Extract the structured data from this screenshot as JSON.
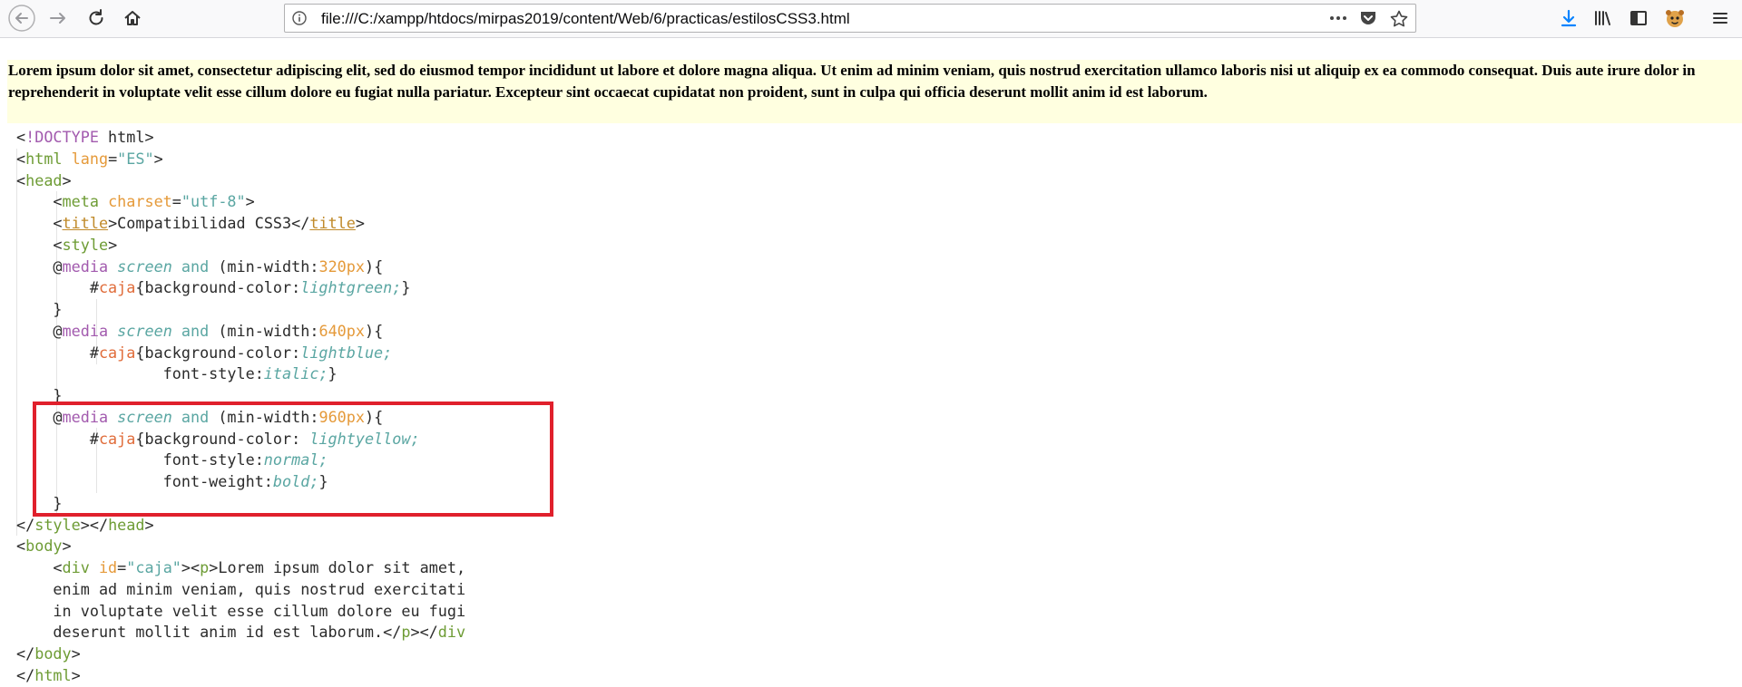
{
  "browser": {
    "url": "file:///C:/xampp/htdocs/mirpas2019/content/Web/6/practicas/estilosCSS3.html",
    "accent_color": "#0a84ff",
    "icons": [
      "back-arrow-icon",
      "forward-arrow-icon",
      "reload-icon",
      "home-icon",
      "info-icon",
      "page-actions-dots-icon",
      "pocket-icon",
      "bookmark-star-icon",
      "download-icon",
      "library-icon",
      "sidebar-icon",
      "extension-avatar-icon",
      "hamburger-menu-icon"
    ]
  },
  "page": {
    "caja_text": "Lorem ipsum dolor sit amet, consectetur adipiscing elit, sed do eiusmod tempor incididunt ut labore et dolore magna aliqua. Ut enim ad minim veniam, quis nostrud exercitation ullamco laboris nisi ut aliquip ex ea commodo consequat. Duis aute irure dolor in reprehenderit in voluptate velit esse cillum dolore eu fugiat nulla pariatur. Excepteur sint occaecat cupidatat non proident, sunt in culpa qui officia deserunt mollit anim id est laborum.",
    "caja_background": "#ffffe0",
    "highlight_color": "#e0202c"
  },
  "code": {
    "doctype_kw": "!DOCTYPE",
    "doctype_rest": " html",
    "html_tag": "html",
    "lang_attr": "lang",
    "lang_val": "\"ES\"",
    "head_tag": "head",
    "meta_tag": "meta",
    "charset_attr": "charset",
    "charset_val": "\"utf-8\"",
    "title_tag": "title",
    "title_text": "Compatibilidad CSS3",
    "style_tag": "style",
    "media_kw": "media",
    "screen_kw": "screen",
    "and_kw": "and",
    "minw_prop": " (min-width:",
    "w320": "320px",
    "w640": "640px",
    "w960": "960px",
    "caja_sel": "caja",
    "bg_prop": "{background-color:",
    "bg_prop_sp": "{background-color: ",
    "lightgreen": "lightgreen",
    "lightblue": "lightblue",
    "lightyellow": "lightyellow",
    "fs_prop": "font-style:",
    "fw_prop": "font-weight:",
    "italic": "italic",
    "normal": "normal",
    "bold": "bold",
    "body_tag": "body",
    "div_tag": "div",
    "id_attr": "id",
    "id_val": "\"caja\"",
    "p_tag": "p",
    "div_line1": "Lorem ipsum dolor sit amet,",
    "div_line2": "enim ad minim veniam, quis nostrud exercitati",
    "div_line3": "in voluptate velit esse cillum dolore eu fugi",
    "div_line4": "deserunt mollit anim id est laborum."
  }
}
